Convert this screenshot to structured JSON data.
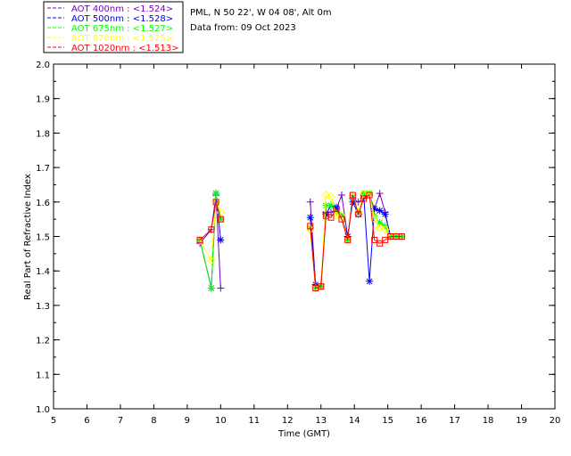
{
  "header": {
    "location": "PML, N 50 22', W 04 08', Alt 0m",
    "date_line": "Data from: 09 Oct 2023"
  },
  "legend": [
    {
      "text": "AOT  400nm : <1.524>",
      "color": "#7a00c8"
    },
    {
      "text": "AOT  500nm : <1.528>",
      "color": "#0000ff"
    },
    {
      "text": "AOT  675nm : <1.527>",
      "color": "#00ff00"
    },
    {
      "text": "AOT  870nm : <1.525>",
      "color": "#ffff00"
    },
    {
      "text": "AOT 1020nm : <1.513>",
      "color": "#ff0000"
    }
  ],
  "chart_data": {
    "type": "line",
    "xlabel": "Time (GMT)",
    "ylabel": "Real Part of Refractive Index",
    "xlim": [
      5,
      20
    ],
    "ylim": [
      1.0,
      2.0
    ],
    "xticks": [
      "5",
      "6",
      "7",
      "8",
      "9",
      "10",
      "11",
      "12",
      "13",
      "14",
      "15",
      "16",
      "17",
      "18",
      "19",
      "20"
    ],
    "yticks": [
      "1.0",
      "1.1",
      "1.2",
      "1.3",
      "1.4",
      "1.5",
      "1.6",
      "1.7",
      "1.8",
      "1.9",
      "2.0"
    ],
    "series": [
      {
        "name": "AOT  400nm : <1.524>",
        "color": "#7a00c8",
        "marker": "plus",
        "x": [
          9.38,
          9.72,
          9.86,
          10.0,
          12.68,
          12.84,
          13.0,
          13.15,
          13.3,
          13.46,
          13.62,
          13.8,
          13.95,
          14.12,
          14.28,
          14.45,
          14.6,
          14.76,
          14.92,
          15.08,
          15.25,
          15.42
        ],
        "y": [
          1.48,
          1.52,
          1.62,
          1.35,
          1.6,
          1.36,
          1.36,
          1.57,
          1.57,
          1.58,
          1.62,
          1.5,
          1.61,
          1.6,
          1.61,
          1.62,
          1.58,
          1.625,
          1.57,
          1.5,
          1.5,
          1.5
        ]
      },
      {
        "name": "AOT  500nm : <1.528>",
        "color": "#0000ff",
        "marker": "star",
        "x": [
          9.38,
          9.72,
          9.86,
          10.0,
          12.68,
          12.84,
          13.0,
          13.15,
          13.3,
          13.46,
          13.62,
          13.8,
          13.95,
          14.12,
          14.28,
          14.45,
          14.6,
          14.76,
          14.92,
          15.08,
          15.25,
          15.42
        ],
        "y": [
          1.49,
          1.35,
          1.625,
          1.49,
          1.555,
          1.36,
          1.355,
          1.565,
          1.59,
          1.585,
          1.56,
          1.5,
          1.6,
          1.565,
          1.62,
          1.37,
          1.58,
          1.575,
          1.565,
          1.5,
          1.5,
          1.5
        ]
      },
      {
        "name": "AOT  675nm : <1.527>",
        "color": "#00ff00",
        "marker": "star",
        "x": [
          9.38,
          9.72,
          9.86,
          10.0,
          12.68,
          12.84,
          13.0,
          13.15,
          13.3,
          13.46,
          13.62,
          13.8,
          13.95,
          14.12,
          14.28,
          14.45,
          14.6,
          14.76,
          14.92,
          15.08,
          15.25,
          15.42
        ],
        "y": [
          1.49,
          1.35,
          1.625,
          1.55,
          1.525,
          1.35,
          1.355,
          1.59,
          1.59,
          1.57,
          1.56,
          1.49,
          1.615,
          1.57,
          1.625,
          1.625,
          1.56,
          1.54,
          1.53,
          1.5,
          1.5,
          1.5
        ]
      },
      {
        "name": "AOT  870nm : <1.525>",
        "color": "#ffff00",
        "marker": "diamond",
        "x": [
          9.38,
          9.72,
          9.86,
          10.0,
          12.68,
          12.84,
          13.0,
          13.15,
          13.3,
          13.46,
          13.62,
          13.8,
          13.95,
          14.12,
          14.28,
          14.45,
          14.6,
          14.76,
          14.92,
          15.08,
          15.25,
          15.42
        ],
        "y": [
          1.49,
          1.43,
          1.6,
          1.57,
          1.52,
          1.35,
          1.355,
          1.62,
          1.615,
          1.56,
          1.56,
          1.49,
          1.62,
          1.57,
          1.625,
          1.625,
          1.55,
          1.525,
          1.52,
          1.5,
          1.5,
          1.5
        ]
      },
      {
        "name": "AOT 1020nm : <1.513>",
        "color": "#ff0000",
        "marker": "square",
        "x": [
          9.38,
          9.72,
          9.86,
          10.0,
          12.68,
          12.84,
          13.0,
          13.15,
          13.3,
          13.46,
          13.62,
          13.8,
          13.95,
          14.12,
          14.28,
          14.45,
          14.6,
          14.76,
          14.92,
          15.08,
          15.25,
          15.42
        ],
        "y": [
          1.49,
          1.52,
          1.6,
          1.55,
          1.53,
          1.35,
          1.355,
          1.56,
          1.555,
          1.58,
          1.55,
          1.49,
          1.62,
          1.565,
          1.61,
          1.62,
          1.49,
          1.48,
          1.49,
          1.5,
          1.5,
          1.5
        ]
      }
    ]
  }
}
